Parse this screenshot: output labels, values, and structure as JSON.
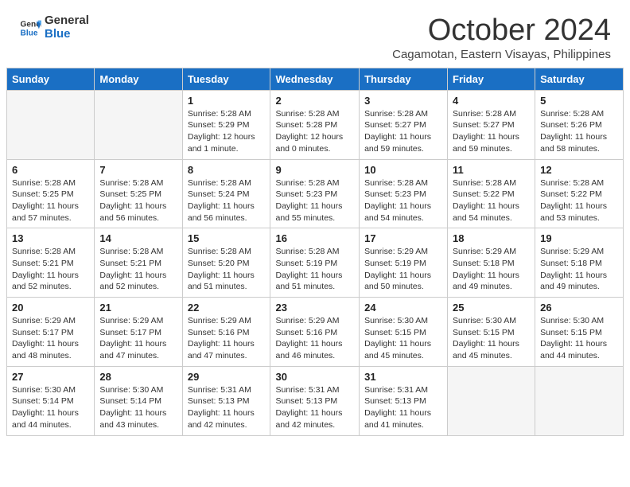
{
  "header": {
    "logo_line1": "General",
    "logo_line2": "Blue",
    "month_title": "October 2024",
    "subtitle": "Cagamotan, Eastern Visayas, Philippines"
  },
  "weekdays": [
    "Sunday",
    "Monday",
    "Tuesday",
    "Wednesday",
    "Thursday",
    "Friday",
    "Saturday"
  ],
  "weeks": [
    [
      {
        "day": "",
        "empty": true
      },
      {
        "day": "",
        "empty": true
      },
      {
        "day": "1",
        "sunrise": "5:28 AM",
        "sunset": "5:29 PM",
        "daylight": "12 hours and 1 minute."
      },
      {
        "day": "2",
        "sunrise": "5:28 AM",
        "sunset": "5:28 PM",
        "daylight": "12 hours and 0 minutes."
      },
      {
        "day": "3",
        "sunrise": "5:28 AM",
        "sunset": "5:27 PM",
        "daylight": "11 hours and 59 minutes."
      },
      {
        "day": "4",
        "sunrise": "5:28 AM",
        "sunset": "5:27 PM",
        "daylight": "11 hours and 59 minutes."
      },
      {
        "day": "5",
        "sunrise": "5:28 AM",
        "sunset": "5:26 PM",
        "daylight": "11 hours and 58 minutes."
      }
    ],
    [
      {
        "day": "6",
        "sunrise": "5:28 AM",
        "sunset": "5:25 PM",
        "daylight": "11 hours and 57 minutes."
      },
      {
        "day": "7",
        "sunrise": "5:28 AM",
        "sunset": "5:25 PM",
        "daylight": "11 hours and 56 minutes."
      },
      {
        "day": "8",
        "sunrise": "5:28 AM",
        "sunset": "5:24 PM",
        "daylight": "11 hours and 56 minutes."
      },
      {
        "day": "9",
        "sunrise": "5:28 AM",
        "sunset": "5:23 PM",
        "daylight": "11 hours and 55 minutes."
      },
      {
        "day": "10",
        "sunrise": "5:28 AM",
        "sunset": "5:23 PM",
        "daylight": "11 hours and 54 minutes."
      },
      {
        "day": "11",
        "sunrise": "5:28 AM",
        "sunset": "5:22 PM",
        "daylight": "11 hours and 54 minutes."
      },
      {
        "day": "12",
        "sunrise": "5:28 AM",
        "sunset": "5:22 PM",
        "daylight": "11 hours and 53 minutes."
      }
    ],
    [
      {
        "day": "13",
        "sunrise": "5:28 AM",
        "sunset": "5:21 PM",
        "daylight": "11 hours and 52 minutes."
      },
      {
        "day": "14",
        "sunrise": "5:28 AM",
        "sunset": "5:21 PM",
        "daylight": "11 hours and 52 minutes."
      },
      {
        "day": "15",
        "sunrise": "5:28 AM",
        "sunset": "5:20 PM",
        "daylight": "11 hours and 51 minutes."
      },
      {
        "day": "16",
        "sunrise": "5:28 AM",
        "sunset": "5:19 PM",
        "daylight": "11 hours and 51 minutes."
      },
      {
        "day": "17",
        "sunrise": "5:29 AM",
        "sunset": "5:19 PM",
        "daylight": "11 hours and 50 minutes."
      },
      {
        "day": "18",
        "sunrise": "5:29 AM",
        "sunset": "5:18 PM",
        "daylight": "11 hours and 49 minutes."
      },
      {
        "day": "19",
        "sunrise": "5:29 AM",
        "sunset": "5:18 PM",
        "daylight": "11 hours and 49 minutes."
      }
    ],
    [
      {
        "day": "20",
        "sunrise": "5:29 AM",
        "sunset": "5:17 PM",
        "daylight": "11 hours and 48 minutes."
      },
      {
        "day": "21",
        "sunrise": "5:29 AM",
        "sunset": "5:17 PM",
        "daylight": "11 hours and 47 minutes."
      },
      {
        "day": "22",
        "sunrise": "5:29 AM",
        "sunset": "5:16 PM",
        "daylight": "11 hours and 47 minutes."
      },
      {
        "day": "23",
        "sunrise": "5:29 AM",
        "sunset": "5:16 PM",
        "daylight": "11 hours and 46 minutes."
      },
      {
        "day": "24",
        "sunrise": "5:30 AM",
        "sunset": "5:15 PM",
        "daylight": "11 hours and 45 minutes."
      },
      {
        "day": "25",
        "sunrise": "5:30 AM",
        "sunset": "5:15 PM",
        "daylight": "11 hours and 45 minutes."
      },
      {
        "day": "26",
        "sunrise": "5:30 AM",
        "sunset": "5:15 PM",
        "daylight": "11 hours and 44 minutes."
      }
    ],
    [
      {
        "day": "27",
        "sunrise": "5:30 AM",
        "sunset": "5:14 PM",
        "daylight": "11 hours and 44 minutes."
      },
      {
        "day": "28",
        "sunrise": "5:30 AM",
        "sunset": "5:14 PM",
        "daylight": "11 hours and 43 minutes."
      },
      {
        "day": "29",
        "sunrise": "5:31 AM",
        "sunset": "5:13 PM",
        "daylight": "11 hours and 42 minutes."
      },
      {
        "day": "30",
        "sunrise": "5:31 AM",
        "sunset": "5:13 PM",
        "daylight": "11 hours and 42 minutes."
      },
      {
        "day": "31",
        "sunrise": "5:31 AM",
        "sunset": "5:13 PM",
        "daylight": "11 hours and 41 minutes."
      },
      {
        "day": "",
        "empty": true
      },
      {
        "day": "",
        "empty": true
      }
    ]
  ],
  "labels": {
    "sunrise": "Sunrise:",
    "sunset": "Sunset:",
    "daylight": "Daylight:"
  }
}
